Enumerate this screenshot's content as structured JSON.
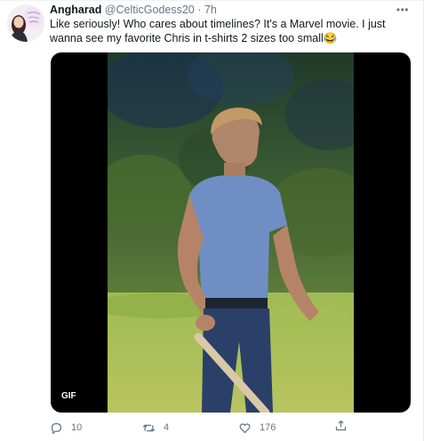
{
  "tweet": {
    "display_name": "Angharad",
    "handle": "@CelticGodess20",
    "separator": "·",
    "time": "7h",
    "more_label": "•••",
    "text": "Like seriously! Who cares about timelines? It's a Marvel movie. I just wanna see my favorite Chris in t-shirts 2 sizes too small😂",
    "media": {
      "badge": "GIF"
    },
    "actions": {
      "reply_count": "10",
      "retweet_count": "4",
      "like_count": "176"
    }
  },
  "colors": {
    "secondary_text": "#657786",
    "primary_text": "#14171a",
    "media_background": "#000000"
  },
  "icons": [
    "more-icon",
    "reply-icon",
    "retweet-icon",
    "like-icon",
    "share-icon"
  ]
}
